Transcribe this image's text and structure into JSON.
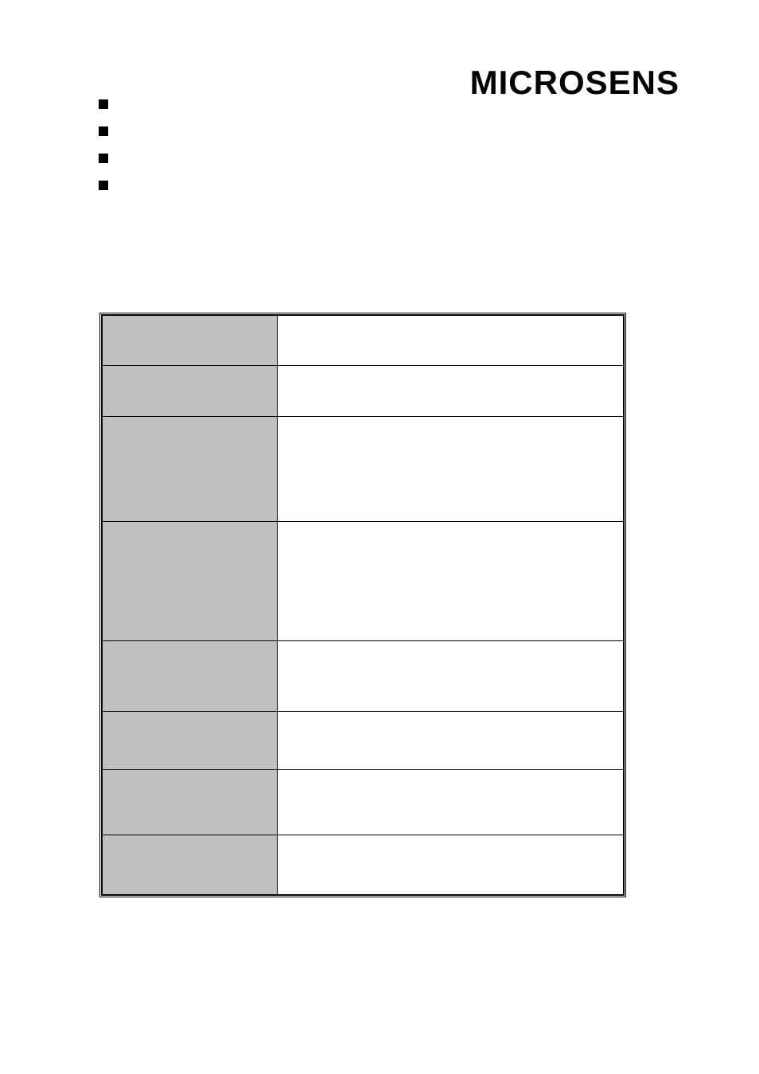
{
  "logo": "MICROSENS",
  "bullets": [
    "",
    "",
    "",
    ""
  ],
  "table": {
    "rows": [
      {
        "label": "",
        "value": "",
        "height": "row-h-63"
      },
      {
        "label": "",
        "value": "",
        "height": "row-h-64"
      },
      {
        "label": "",
        "value": "",
        "height": "row-h-132"
      },
      {
        "label": "",
        "value": "",
        "height": "row-h-150"
      },
      {
        "label": "",
        "value": "",
        "height": "row-h-89"
      },
      {
        "label": "",
        "value": "",
        "height": "row-h-73"
      },
      {
        "label": "",
        "value": "",
        "height": "row-h-82"
      },
      {
        "label": "",
        "value": "",
        "height": "row-h-75"
      }
    ]
  }
}
